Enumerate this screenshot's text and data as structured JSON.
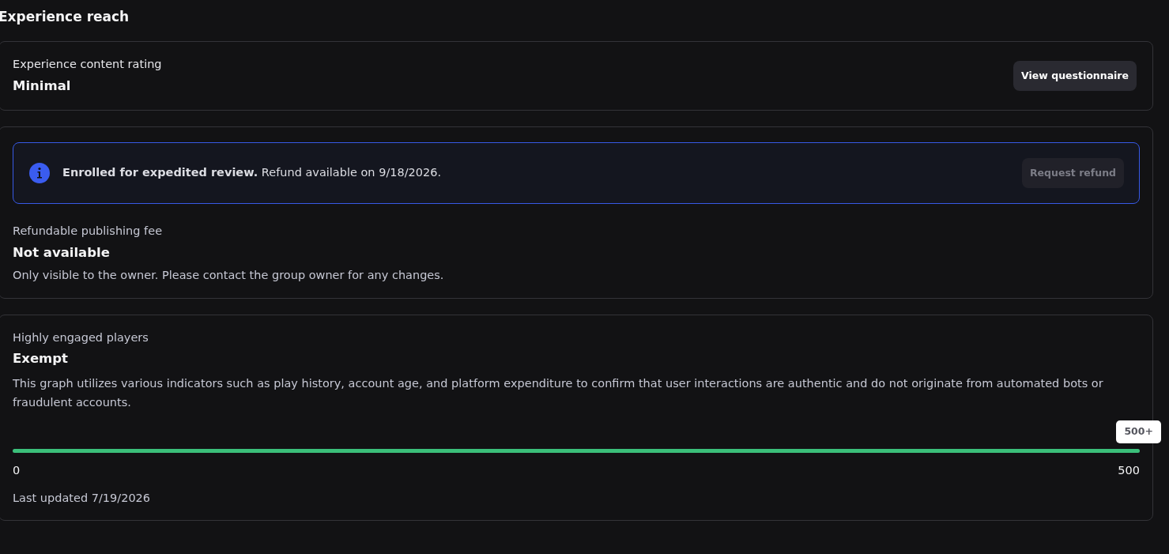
{
  "heading": "Experience reach",
  "content_rating": {
    "label": "Experience content rating",
    "value": "Minimal",
    "button": {
      "label": "View questionnaire",
      "disabled": false
    }
  },
  "publishing_fee": {
    "notice": {
      "text": "**Enrolled for expedited review.** Refund available on 9/18/2026.",
      "button": {
        "label": "Request refund",
        "disabled": true
      }
    },
    "label": "Refundable publishing fee",
    "value": "Not available",
    "description": "Only visible to the owner. Please contact the group owner for any changes."
  },
  "engaged_players": {
    "label": "Highly engaged players",
    "value": "Exempt",
    "description": "This graph utilizes various indicators such as play history, account age, and platform expenditure to confirm that user interactions are authentic and do not originate from automated bots or fraudulent accounts.",
    "progress": {
      "level": 1,
      "tooltip": "500+",
      "min_label": "0",
      "max_label": "500"
    },
    "updated": "Last updated 7/19/2026"
  }
}
